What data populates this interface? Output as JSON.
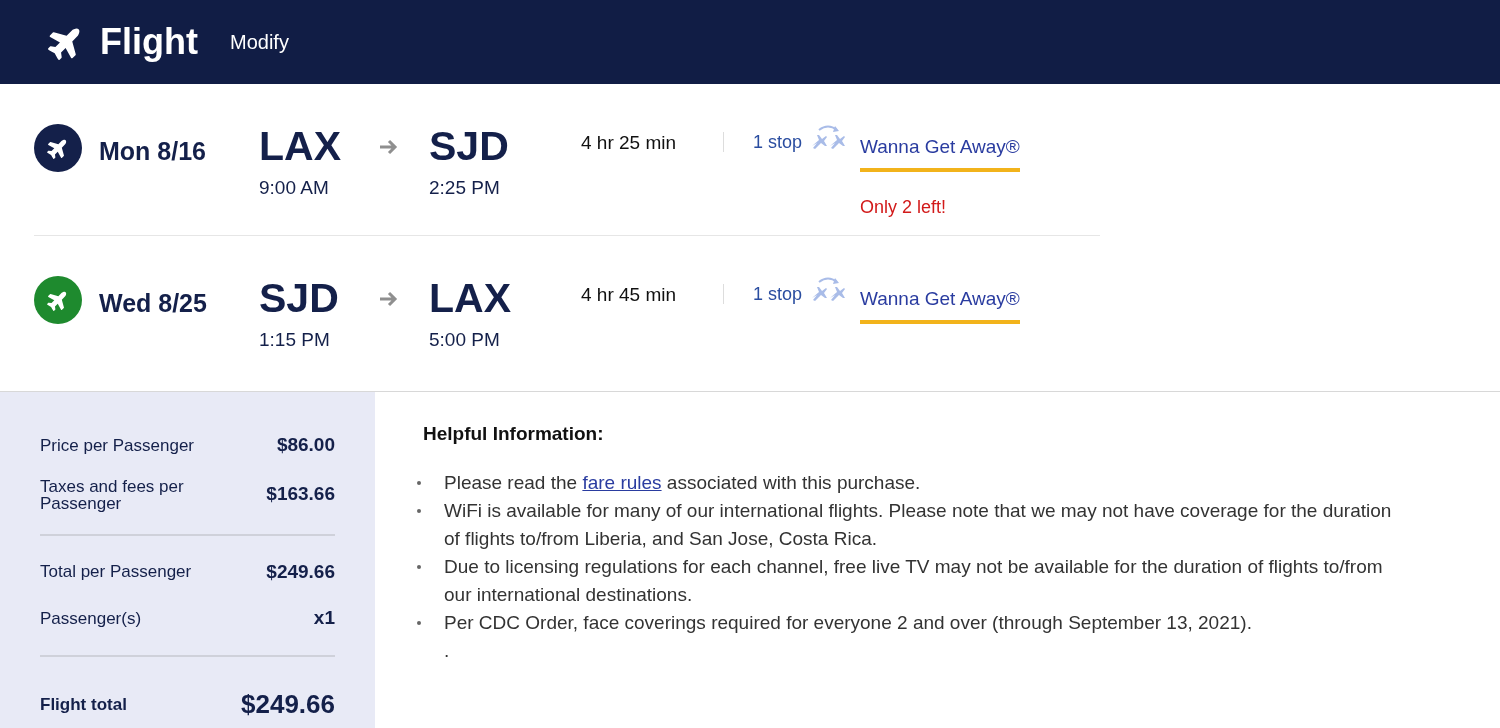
{
  "header": {
    "title": "Flight",
    "link": "Modify"
  },
  "flights": [
    {
      "date": "Mon 8/16",
      "color": "#14204a",
      "origin": "LAX",
      "depart": "9:00 AM",
      "destination": "SJD",
      "arrive": "2:25 PM",
      "duration": "4 hr 25 min",
      "stops": "1 stop",
      "fare": "Wanna Get Away®",
      "notice": "Only 2 left!"
    },
    {
      "date": "Wed 8/25",
      "color": "#1e8a2e",
      "origin": "SJD",
      "depart": "1:15 PM",
      "destination": "LAX",
      "arrive": "5:00 PM",
      "duration": "4 hr 45 min",
      "stops": "1 stop",
      "fare": "Wanna Get Away®"
    }
  ],
  "price_summary": [
    [
      {
        "label": "Price per Passenger",
        "value": "$86.00",
        "kind": "line"
      },
      {
        "label": "Taxes and fees per Passenger",
        "value": "$163.66",
        "kind": "line"
      }
    ],
    [
      {
        "label": "Total per Passenger",
        "value": "$249.66",
        "kind": "line"
      },
      {
        "label": "Passenger(s)",
        "value": "x1",
        "kind": "line"
      }
    ],
    [
      {
        "label": "Flight total",
        "value": "$249.66",
        "kind": "total"
      }
    ]
  ],
  "helpful_information": {
    "title": "Helpful Information:",
    "items": [
      {
        "text": "Please read the ",
        "link": "fare rules",
        "after": " associated with this purchase."
      },
      {
        "text": "WiFi is available for many of our international flights. Please note that we may not have coverage for the duration of flights to/from Liberia, and San Jose, Costa Rica."
      },
      {
        "text": "Due to licensing regulations for each channel, free live TV may not be available for the duration of flights to/from our international destinations."
      },
      {
        "text": "Per CDC Order, face coverings required for everyone 2 and over (through September 13, 2021)."
      }
    ],
    "footer": "."
  }
}
